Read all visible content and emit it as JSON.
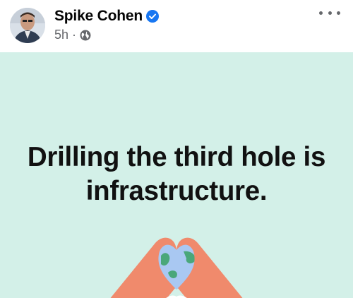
{
  "post": {
    "author": "Spike Cohen",
    "verified": true,
    "time": "5h",
    "separator": "·",
    "audience_icon": "globe-icon",
    "more_icon": "more-options-icon"
  },
  "image": {
    "background_color": "#d3f0e8",
    "text_line_1": "Drilling the third hole is",
    "text_line_2": "infrastructure.",
    "illustration": "hands-heart-globe-icon"
  },
  "colors": {
    "verified_blue": "#1877f2",
    "hands": "#f08a6c",
    "globe_water": "#a9c8f2",
    "globe_land": "#4aa77a"
  }
}
